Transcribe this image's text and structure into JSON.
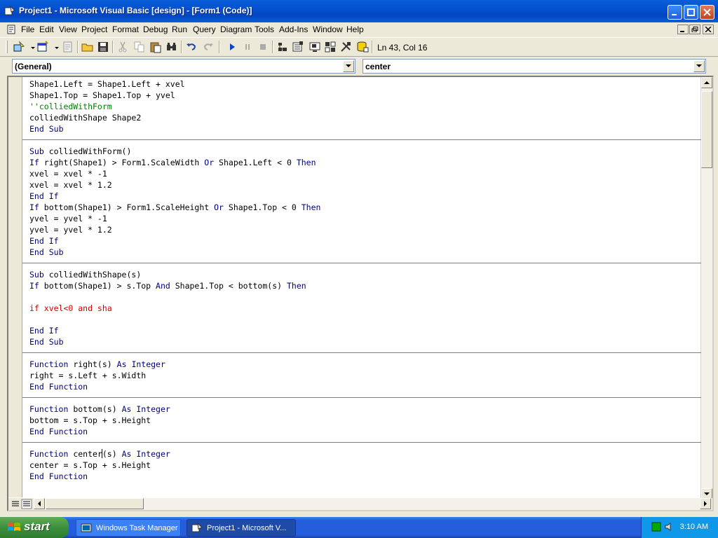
{
  "window": {
    "title": "Project1 - Microsoft Visual Basic [design] - [Form1 (Code)]"
  },
  "menu": [
    "File",
    "Edit",
    "View",
    "Project",
    "Format",
    "Debug",
    "Run",
    "Query",
    "Diagram",
    "Tools",
    "Add-Ins",
    "Window",
    "Help"
  ],
  "toolbar": {
    "position": "Ln 43, Col 16"
  },
  "combos": {
    "object": "(General)",
    "procedure": "center"
  },
  "code": {
    "blocks": [
      [
        "Shape1.Left = Shape1.Left + xvel",
        "Shape1.Top = Shape1.Top + yvel",
        "''colliedWithForm",
        "colliedWithShape Shape2",
        "End Sub"
      ],
      [
        "",
        "Sub colliedWithForm()",
        "If right(Shape1) > Form1.ScaleWidth Or Shape1.Left < 0 Then",
        "xvel = xvel * -1",
        "xvel = xvel * 1.2",
        "End If",
        "If bottom(Shape1) > Form1.ScaleHeight Or Shape1.Top < 0 Then",
        "yvel = yvel * -1",
        "yvel = yvel * 1.2",
        "End If",
        "End Sub"
      ],
      [
        "",
        "Sub colliedWithShape(s)",
        "If bottom(Shape1) > s.Top And Shape1.Top < bottom(s) Then",
        "",
        "if xvel<0 and sha",
        "",
        "End If",
        "End Sub"
      ],
      [
        "",
        "Function right(s) As Integer",
        "right = s.Left + s.Width",
        "End Function"
      ],
      [
        "",
        "Function bottom(s) As Integer",
        "bottom = s.Top + s.Height",
        "End Function"
      ],
      [
        "",
        "Function center(s) As Integer",
        "center = s.Top + s.Height",
        "End Function"
      ]
    ]
  },
  "taskbar": {
    "start_label": "start",
    "tasks": [
      "Windows Task Manager",
      "Project1 - Microsoft V..."
    ],
    "clock": "3:10 AM"
  },
  "colors": {
    "keyword": "#00007f",
    "comment": "#007f00",
    "error": "#d40000"
  }
}
